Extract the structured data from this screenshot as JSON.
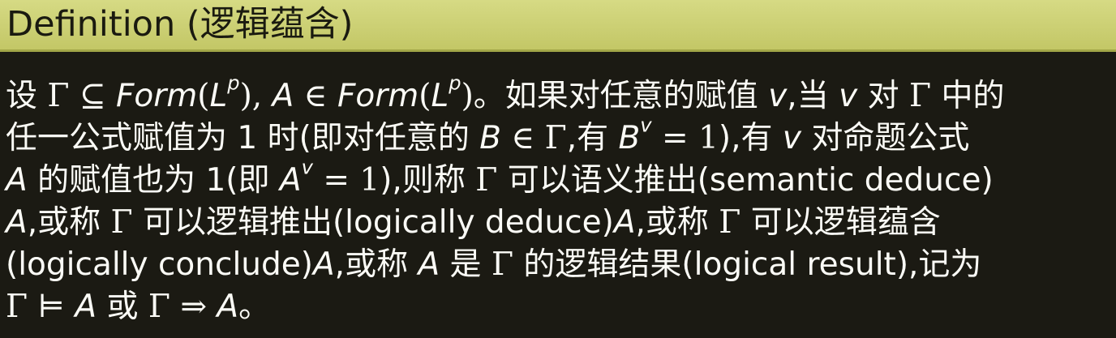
{
  "title": "Definition (逻辑蕴含)",
  "paragraph_lines": [
    [
      {
        "t": "设 "
      },
      {
        "t": "Γ ⊆ ",
        "s": "m"
      },
      {
        "t": "Form",
        "s": "it"
      },
      {
        "t": "(",
        "s": "m"
      },
      {
        "t": "L",
        "s": "it"
      },
      {
        "t": "p",
        "s": "sup-it"
      },
      {
        "t": "), ",
        "s": "m"
      },
      {
        "t": "A",
        "s": "it"
      },
      {
        "t": " ∈ ",
        "s": "m"
      },
      {
        "t": "Form",
        "s": "it"
      },
      {
        "t": "(",
        "s": "m"
      },
      {
        "t": "L",
        "s": "it"
      },
      {
        "t": "p",
        "s": "sup-it"
      },
      {
        "t": ")",
        "s": "m"
      },
      {
        "t": "。如果对任意的赋值 "
      },
      {
        "t": "v",
        "s": "it"
      },
      {
        "t": ",当 "
      },
      {
        "t": "v",
        "s": "it"
      },
      {
        "t": " 对 "
      },
      {
        "t": "Γ",
        "s": "m"
      },
      {
        "t": " 中的"
      }
    ],
    [
      {
        "t": "任一公式赋值为 1 时(即对任意的 "
      },
      {
        "t": "B",
        "s": "it"
      },
      {
        "t": " ∈ Γ",
        "s": "m"
      },
      {
        "t": ",有 "
      },
      {
        "t": "B",
        "s": "it"
      },
      {
        "t": "v",
        "s": "sup-it"
      },
      {
        "t": " = 1",
        "s": "m"
      },
      {
        "t": "),有 "
      },
      {
        "t": "v",
        "s": "it"
      },
      {
        "t": " 对命题公式"
      }
    ],
    [
      {
        "t": "A",
        "s": "it"
      },
      {
        "t": " 的赋值也为 1(即 "
      },
      {
        "t": "A",
        "s": "it"
      },
      {
        "t": "v",
        "s": "sup-it"
      },
      {
        "t": " = 1",
        "s": "m"
      },
      {
        "t": "),则称 "
      },
      {
        "t": "Γ",
        "s": "m"
      },
      {
        "t": " 可以语义推出(semantic deduce)"
      }
    ],
    [
      {
        "t": "A",
        "s": "it"
      },
      {
        "t": ",或称 "
      },
      {
        "t": "Γ",
        "s": "m"
      },
      {
        "t": " 可以逻辑推出(logically deduce)"
      },
      {
        "t": "A",
        "s": "it"
      },
      {
        "t": ",或称 "
      },
      {
        "t": "Γ",
        "s": "m"
      },
      {
        "t": " 可以逻辑蕴含"
      }
    ],
    [
      {
        "t": "(logically conclude)"
      },
      {
        "t": "A",
        "s": "it"
      },
      {
        "t": ",或称 "
      },
      {
        "t": "A",
        "s": "it"
      },
      {
        "t": " 是 "
      },
      {
        "t": "Γ",
        "s": "m"
      },
      {
        "t": " 的逻辑结果(logical result),记为"
      }
    ],
    [
      {
        "t": "Γ ⊨ ",
        "s": "m"
      },
      {
        "t": "A",
        "s": "it"
      },
      {
        "t": " 或 "
      },
      {
        "t": "Γ ⇒ ",
        "s": "m"
      },
      {
        "t": "A",
        "s": "it"
      },
      {
        "t": "。"
      }
    ]
  ]
}
